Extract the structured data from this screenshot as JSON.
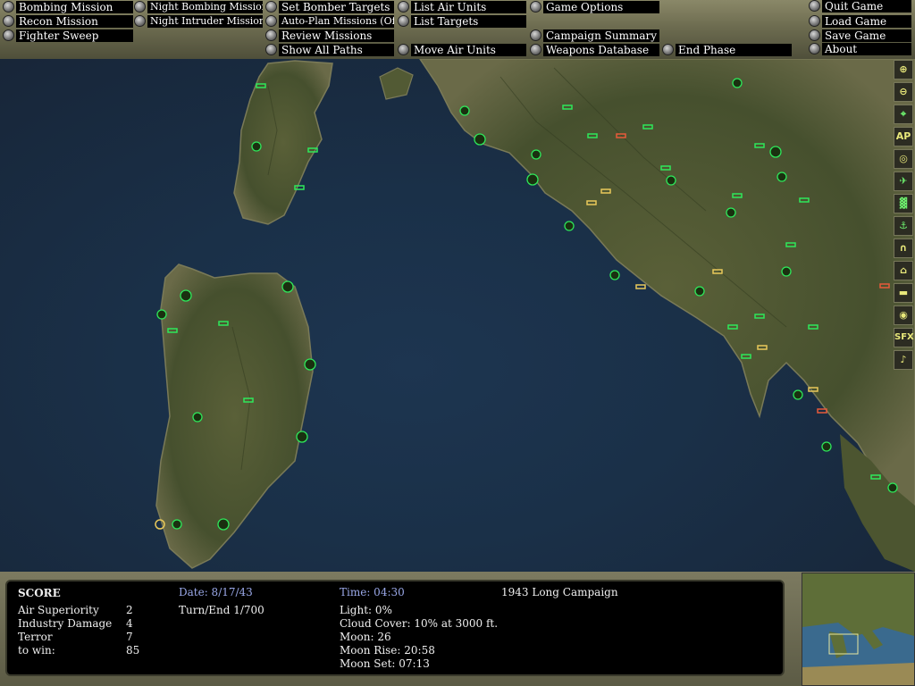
{
  "menu": {
    "bombing_mission": "Bombing Mission",
    "recon_mission": "Recon Mission",
    "fighter_sweep": "Fighter Sweep",
    "night_bombing_mission": "Night Bombing Mission",
    "night_intruder_mission": "Night Intruder Mission",
    "set_bomber_targets": "Set Bomber Targets",
    "auto_plan_missions": "Auto-Plan Missions (Off)",
    "review_missions": "Review Missions",
    "show_all_paths": "Show All Paths",
    "list_air_units": "List Air Units",
    "list_targets": "List Targets",
    "move_air_units": "Move Air Units",
    "game_options": "Game Options",
    "campaign_summary": "Campaign Summary",
    "weapons_database": "Weapons Database",
    "end_phase": "End Phase",
    "quit_game": "Quit Game",
    "load_game": "Load Game",
    "save_game": "Save Game",
    "about": "About"
  },
  "toolbar": {
    "zoom_in": "zoom-in-icon",
    "zoom_out": "zoom-out-icon",
    "target": "crosshair-icon",
    "ap_label": "AP",
    "compass": "compass-icon",
    "aircraft": "aircraft-icon",
    "factory": "factory-icon",
    "anchor": "anchor-icon",
    "bridge": "bridge-icon",
    "building": "building-icon",
    "ship": "ship-icon",
    "radar": "radar-icon",
    "sfx_label": "SFX",
    "music": "music-note-icon"
  },
  "score": {
    "heading": "SCORE",
    "rows": [
      {
        "label": "Air Superiority",
        "value": "2"
      },
      {
        "label": "Industry Damage",
        "value": "4"
      },
      {
        "label": "Terror",
        "value": "7"
      },
      {
        "label": "to win:",
        "value": "85"
      }
    ]
  },
  "status": {
    "date": "Date: 8/17/43",
    "turn": "Turn/End 1/700",
    "time": "Time: 04:30",
    "campaign": "1943 Long Campaign",
    "light": "Light: 0%",
    "cloud": "Cloud Cover: 10% at 3000 ft.",
    "moon": "Moon: 26",
    "moon_rise": "Moon Rise: 20:58",
    "moon_set": "Moon Set: 07:13"
  },
  "colors": {
    "menu_label_bg": "#000000",
    "friendly_marker": "#2ee85a",
    "axis_marker": "#e8c85a",
    "enemy_marker": "#e85a3a",
    "sea": "#1a3048",
    "land": "#4d5a32"
  }
}
